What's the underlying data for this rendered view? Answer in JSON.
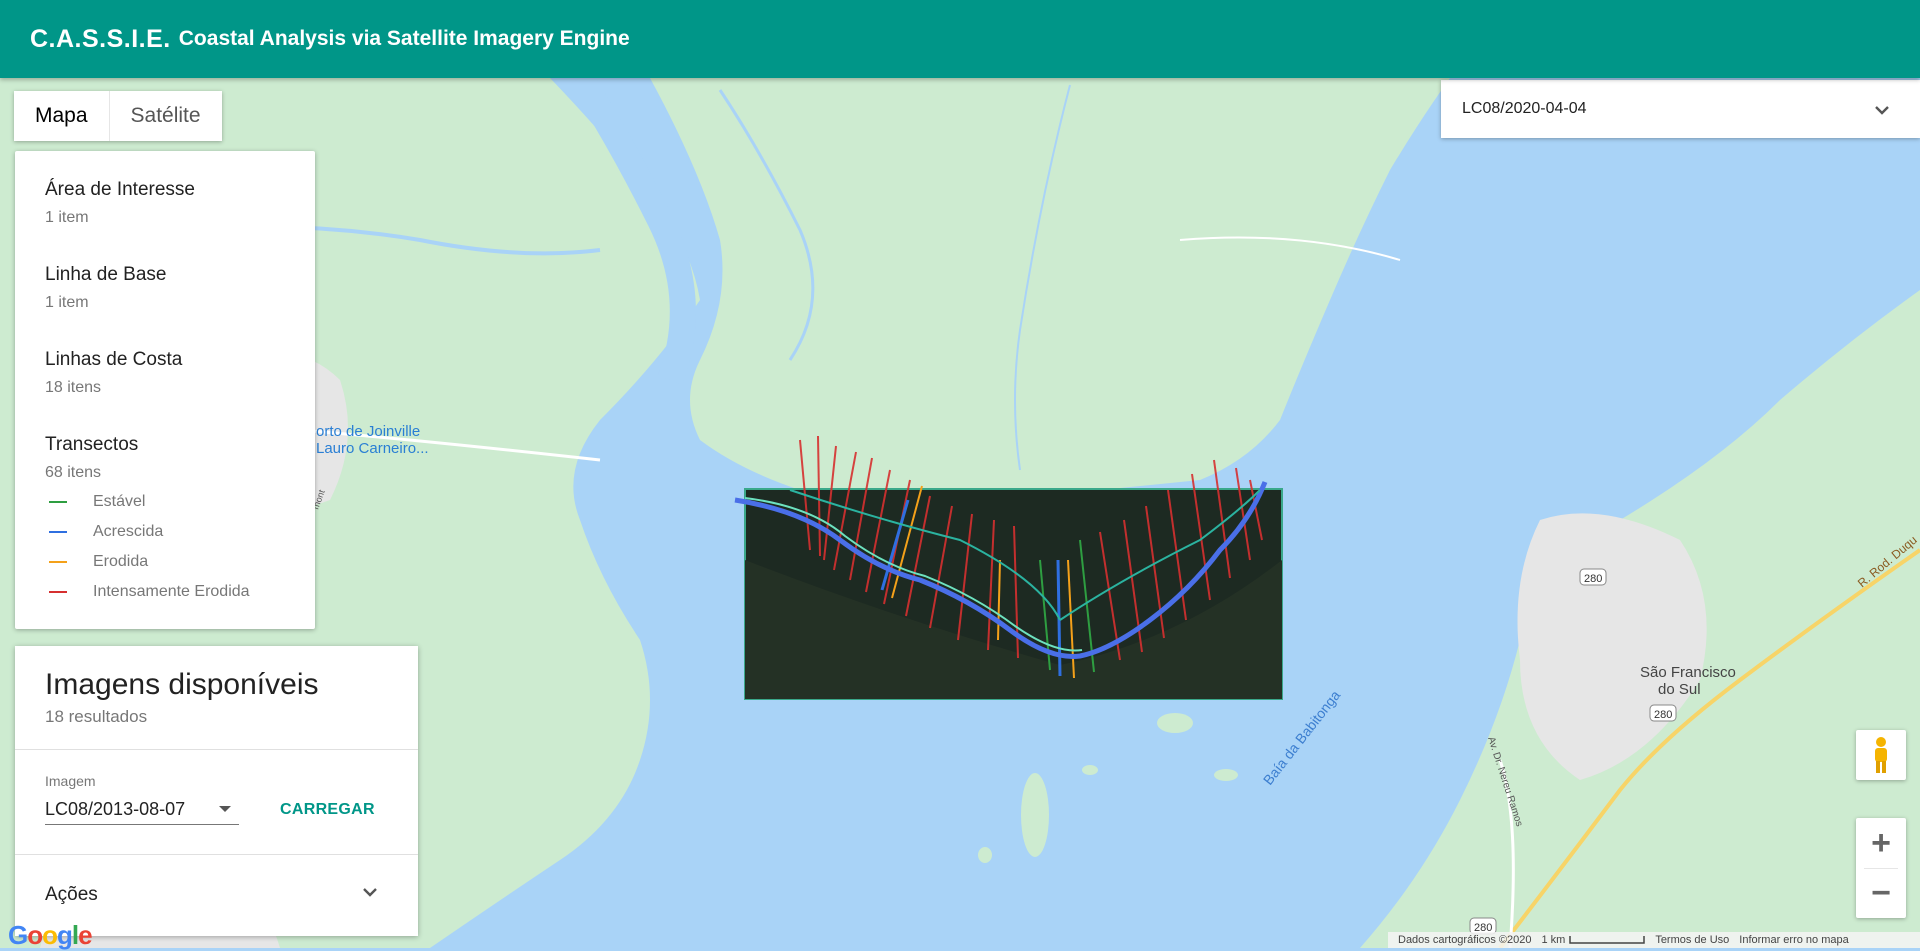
{
  "header": {
    "brand": "C.A.S.S.I.E.",
    "subtitle": "Coastal Analysis via Satellite Imagery Engine"
  },
  "colors": {
    "primary": "#009688",
    "water": "#a9d3f7",
    "land": "#cdebd0",
    "urban": "#e8e8e8",
    "stable": "#2e9e41",
    "accreted": "#2f6fe0",
    "eroded": "#f4a11a",
    "intensely_eroded": "#d63030"
  },
  "map_type": {
    "map_label": "Mapa",
    "satellite_label": "Satélite"
  },
  "layers": [
    {
      "title": "Área de Interesse",
      "count": "1 item"
    },
    {
      "title": "Linha de Base",
      "count": "1 item"
    },
    {
      "title": "Linhas de Costa",
      "count": "18 itens"
    },
    {
      "title": "Transectos",
      "count": "68 itens"
    }
  ],
  "legend": [
    {
      "label": "Estável",
      "color": "#2e9e41"
    },
    {
      "label": "Acrescida",
      "color": "#2f6fe0"
    },
    {
      "label": "Erodida",
      "color": "#f4a11a"
    },
    {
      "label": "Intensamente Erodida",
      "color": "#d63030"
    }
  ],
  "images_panel": {
    "title": "Imagens disponíveis",
    "subtitle": "18 resultados",
    "field_label": "Imagem",
    "selected_image": "LC08/2013-08-07",
    "load_button": "CARREGAR",
    "actions_label": "Ações"
  },
  "date_selector": {
    "value": "LC08/2020-04-04"
  },
  "map_labels": {
    "airport_line1": "orto de Joinville",
    "airport_line2": "Lauro Carneiro...",
    "bay": "Baía da Babitonga",
    "city_line1": "São Francisco",
    "city_line2": "do Sul",
    "road_280a": "280",
    "road_280b": "280",
    "road_280c": "280",
    "road_duque": "R. Rod. Duqu",
    "avenue": "Av. Dr. Nereu Ramos",
    "side_road": "mont"
  },
  "zoom": {
    "in_label": "+",
    "out_label": "−"
  },
  "footer": {
    "data": "Dados cartográficos ©2020",
    "scale": "1 km",
    "terms": "Termos de Uso",
    "report": "Informar erro no mapa"
  },
  "logo": "Google"
}
